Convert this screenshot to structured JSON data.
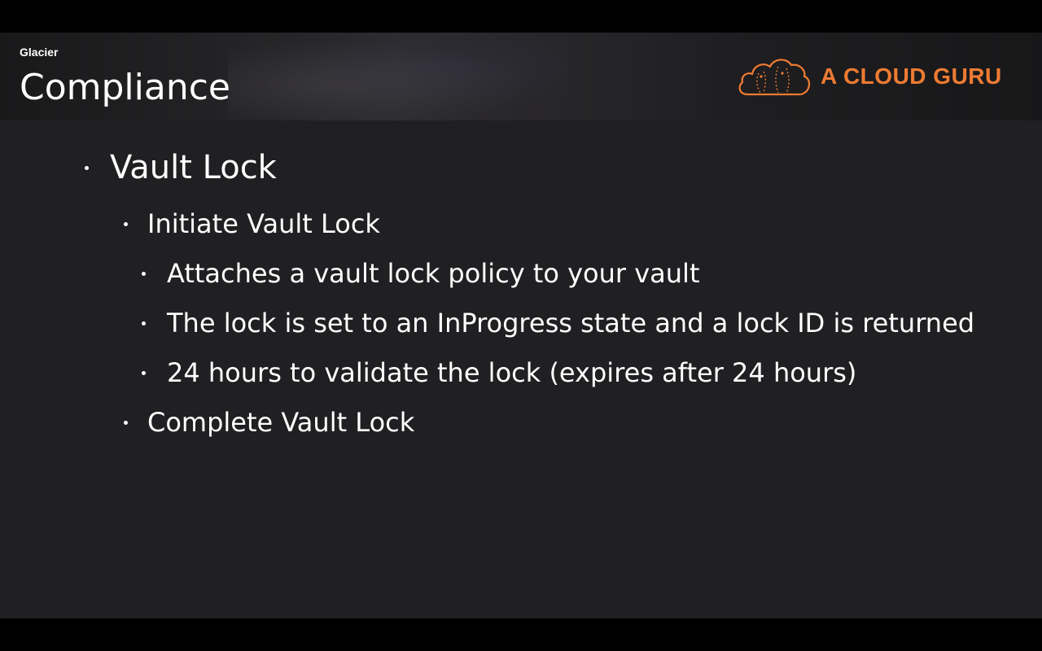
{
  "header": {
    "section_label": "Glacier",
    "title": "Compliance",
    "brand_name": "A CLOUD GURU",
    "brand_logo_icon": "cloud-logo-icon",
    "brand_color": "#ee7b33"
  },
  "colors": {
    "slide_background": "#201f22",
    "text": "#ffffff",
    "letterbox": "#000000"
  },
  "bullets": {
    "level1": {
      "text": "Vault Lock"
    },
    "level2_initiate": {
      "text": "Initiate Vault Lock"
    },
    "level3_items": [
      {
        "text": "Attaches a vault lock policy to your vault"
      },
      {
        "text": "The lock is set to an InProgress state and a lock ID is returned"
      },
      {
        "text": "24 hours to validate the lock (expires after 24 hours)"
      }
    ],
    "level2_complete": {
      "text": "Complete Vault Lock"
    }
  }
}
